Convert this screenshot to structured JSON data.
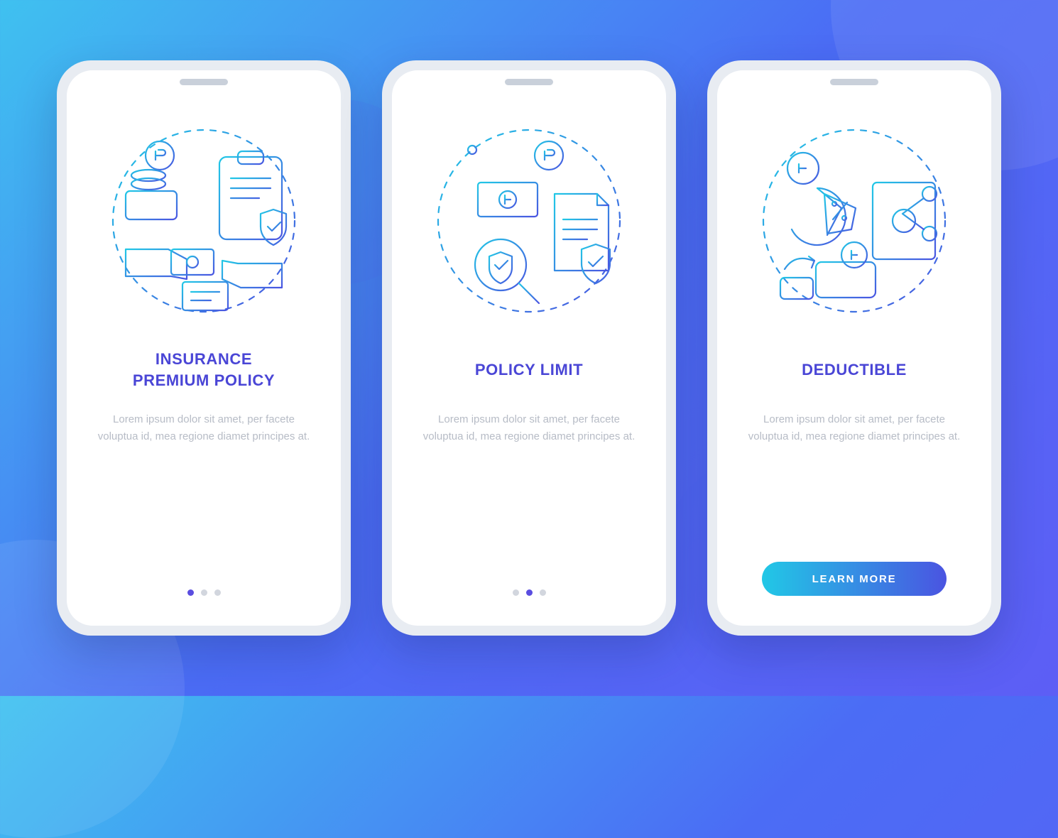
{
  "screens": [
    {
      "title": "INSURANCE\nPREMIUM POLICY",
      "body": "Lorem ipsum dolor sit amet, per facete voluptua id, mea regione diamet principes at.",
      "activeDot": 0,
      "hasCta": false,
      "icon": "premium"
    },
    {
      "title": "POLICY LIMIT",
      "body": "Lorem ipsum dolor sit amet, per facete voluptua id, mea regione diamet principes at.",
      "activeDot": 1,
      "hasCta": false,
      "icon": "limit"
    },
    {
      "title": "DEDUCTIBLE",
      "body": "Lorem ipsum dolor sit amet, per facete voluptua id, mea regione diamet principes at.",
      "activeDot": 2,
      "hasCta": true,
      "icon": "deductible"
    }
  ],
  "cta_label": "LEARN MORE",
  "dot_count": 3,
  "colors": {
    "title": "#4a46d6",
    "body": "#b7bcc6",
    "gradient_start": "#21c8e6",
    "gradient_end": "#4a54e1"
  }
}
